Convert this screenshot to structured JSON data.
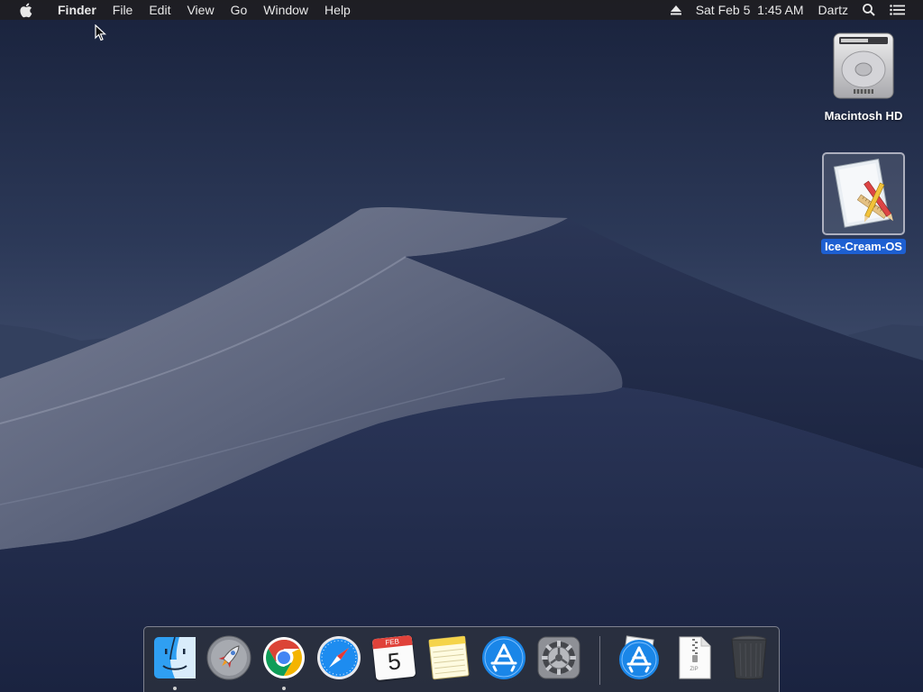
{
  "menubar": {
    "app_name": "Finder",
    "menus": [
      "File",
      "Edit",
      "View",
      "Go",
      "Window",
      "Help"
    ],
    "clock": "Sat Feb 5  1:45 AM",
    "user": "Dartz"
  },
  "desktop": {
    "icons": [
      {
        "label": "Macintosh HD",
        "icon": "hard-drive-icon",
        "selected": false
      },
      {
        "label": "Ice-Cream-OS",
        "icon": "app-installer-icon",
        "selected": true
      }
    ]
  },
  "dock": {
    "calendar": {
      "month": "FEB",
      "day": "5"
    },
    "zip_label": "ZIP",
    "items": [
      {
        "icon": "finder-icon",
        "running": true
      },
      {
        "icon": "launchpad-icon",
        "running": false
      },
      {
        "icon": "chrome-icon",
        "running": true
      },
      {
        "icon": "safari-icon",
        "running": false
      },
      {
        "icon": "calendar-icon",
        "running": false
      },
      {
        "icon": "notes-icon",
        "running": false
      },
      {
        "icon": "app-store-icon",
        "running": false
      },
      {
        "icon": "system-preferences-icon",
        "running": false
      },
      {
        "icon": "downloads-app-store-icon",
        "running": false
      },
      {
        "icon": "zip-file-icon",
        "running": false
      },
      {
        "icon": "trash-icon",
        "running": false
      }
    ]
  },
  "colors": {
    "selection": "#1d5fd1",
    "menubar_bg": "#1e1e22"
  }
}
